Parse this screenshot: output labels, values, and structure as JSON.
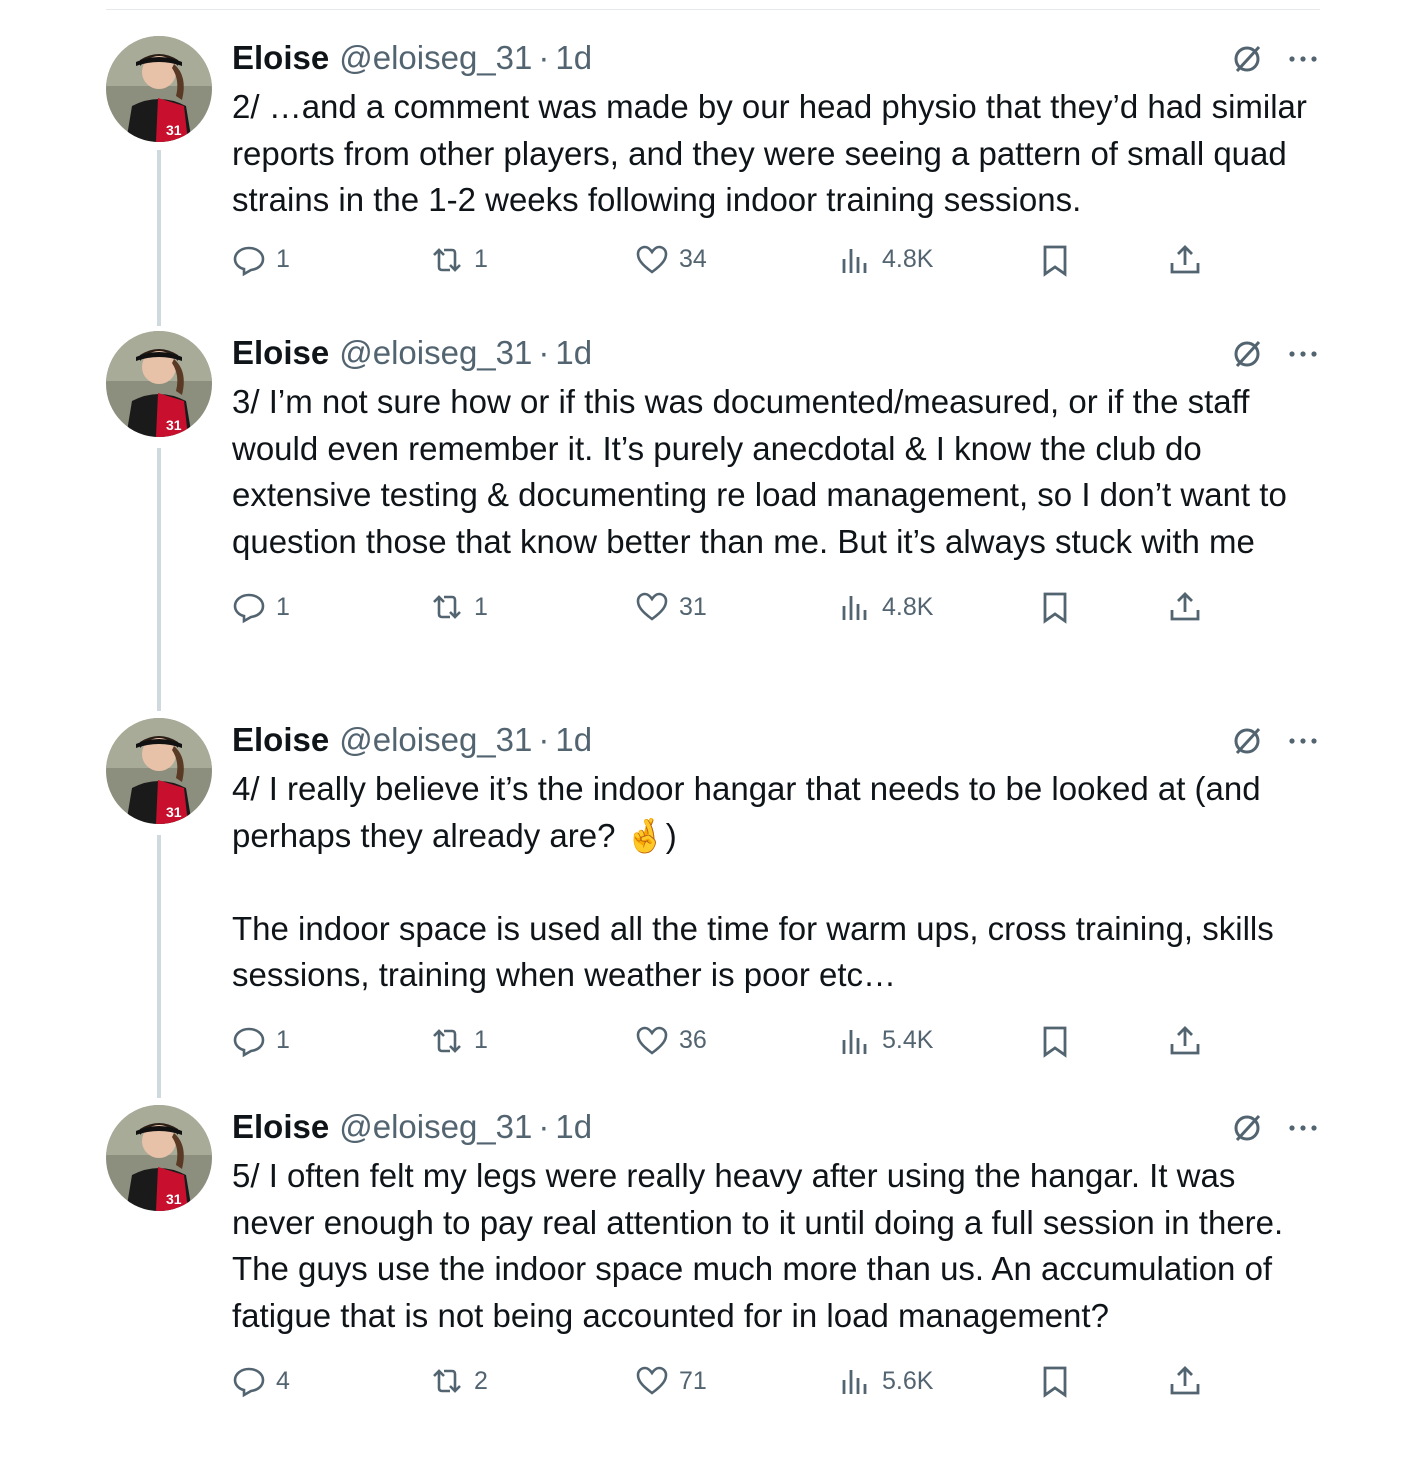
{
  "tweets": [
    {
      "name": "Eloise",
      "handle": "@eloiseg_31",
      "dot": "·",
      "time": "1d",
      "text": "2/ …and a comment was made by our head physio that they’d had similar reports from other players, and they were seeing a pattern of small quad strains in the 1-2 weeks following indoor training sessions.",
      "replies": "1",
      "reposts": "1",
      "likes": "34",
      "views": "4.8K"
    },
    {
      "name": "Eloise",
      "handle": "@eloiseg_31",
      "dot": "·",
      "time": "1d",
      "text": "3/ I’m not sure how or if this was documented/measured, or if the staff would even remember it. It’s purely anecdotal & I know the club do extensive testing & documenting re load management, so I don’t want to question those that know better than me. But it’s always stuck with me",
      "replies": "1",
      "reposts": "1",
      "likes": "31",
      "views": "4.8K"
    },
    {
      "name": "Eloise",
      "handle": "@eloiseg_31",
      "dot": "·",
      "time": "1d",
      "text_line1": "4/ I really believe it’s the indoor hangar that needs to be looked at (and perhaps they already are?",
      "emoji": "🤞",
      "text_close": ")",
      "text_para2": "The indoor space is used all the time for warm ups, cross training, skills sessions, training when weather is poor etc…",
      "replies": "1",
      "reposts": "1",
      "likes": "36",
      "views": "5.4K"
    },
    {
      "name": "Eloise",
      "handle": "@eloiseg_31",
      "dot": "·",
      "time": "1d",
      "text": "5/ I often felt my legs were really heavy after using the hangar. It was never enough to pay real attention to it until doing a full session in there. The guys use the indoor space much more than us. An accumulation of fatigue that is not being accounted for in load management?",
      "replies": "4",
      "reposts": "2",
      "likes": "71",
      "views": "5.6K"
    }
  ],
  "colors": {
    "text": "#0f1419",
    "secondary": "#536471",
    "thread_line": "#cfd9de",
    "jersey_red": "#c8102e"
  },
  "icons": [
    "grok-icon",
    "more-icon",
    "reply-icon",
    "repost-icon",
    "like-icon",
    "views-icon",
    "bookmark-icon",
    "share-icon"
  ]
}
